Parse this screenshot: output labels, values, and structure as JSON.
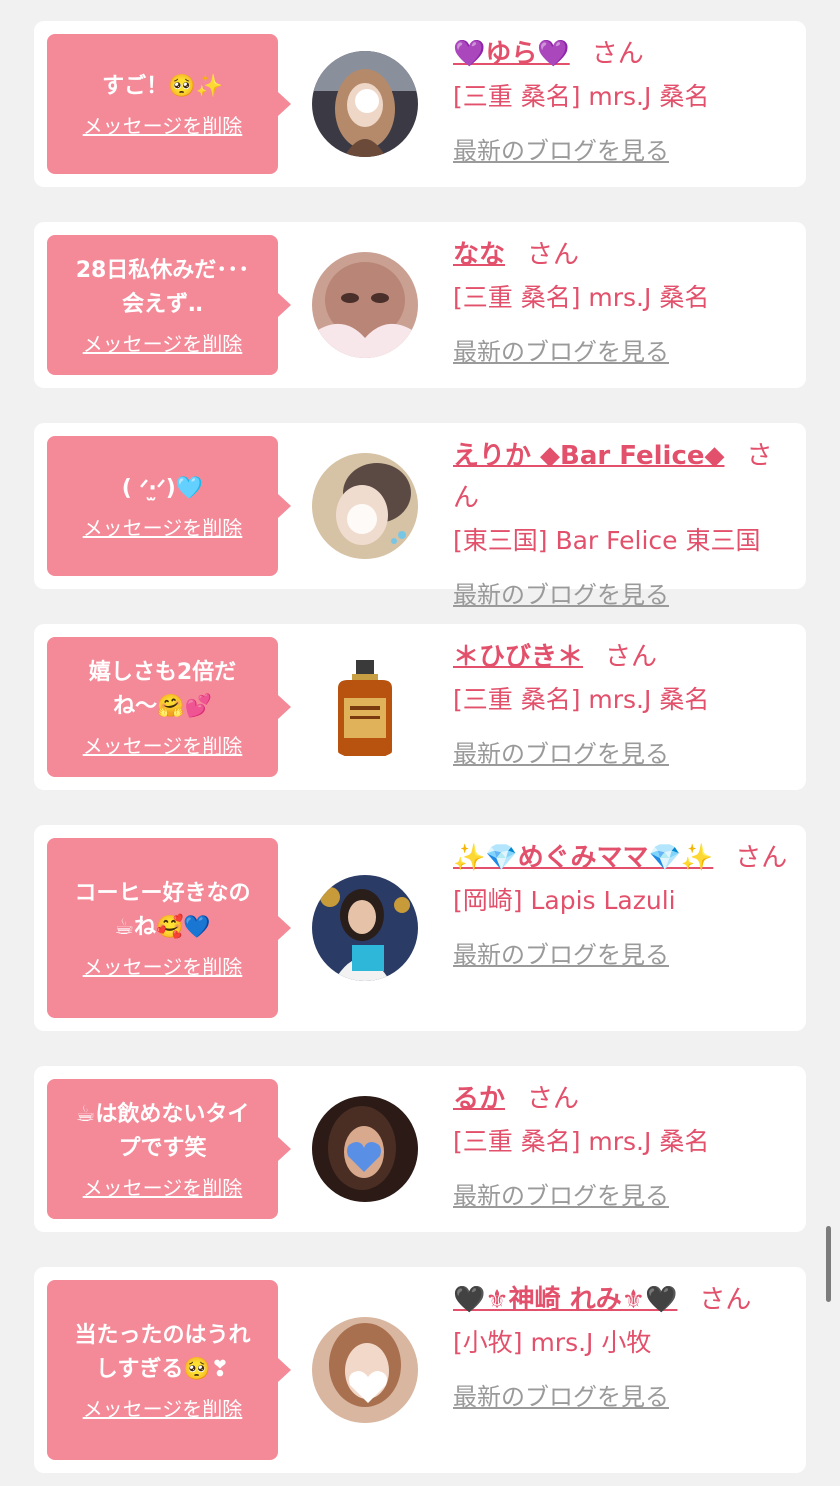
{
  "common": {
    "delete_label": "メッセージを削除",
    "san_label": "さん",
    "blog_label": "最新のブログを見る"
  },
  "colors": {
    "bubble": "#f48a98",
    "name": "#e2506b",
    "blog_link": "#9a9a9a",
    "background": "#f1f1f1"
  },
  "items": [
    {
      "message": "すご！🥺✨",
      "name": "💜ゆら💜",
      "shop": "[三重 桑名] mrs.J 桑名",
      "avatar_icon": "avatar-woman-long-hair-icon"
    },
    {
      "message": "28日私休みだ･･･\n会えず‥",
      "name": "なな",
      "shop": "[三重 桑名] mrs.J 桑名",
      "avatar_icon": "avatar-woman-closeup-icon"
    },
    {
      "message": "( ᐟ‧̫ᐟ)🩵",
      "name": "えりか ◆Bar Felice◆",
      "shop": "[東三国] Bar Felice 東三国",
      "avatar_icon": "avatar-woman-blurred-icon"
    },
    {
      "message": "嬉しさも2倍だ\nね〜🤗💕",
      "name": "＊ひびき＊",
      "shop": "[三重 桑名] mrs.J 桑名",
      "avatar_icon": "whisky-bottle-icon"
    },
    {
      "message": "コーヒー好きなの\n☕ね🥰💙",
      "name": "✨💎めぐみママ💎✨",
      "shop": "[岡崎] Lapis Lazuli",
      "avatar_icon": "avatar-woman-gift-icon"
    },
    {
      "message": "☕は飲めないタイ\nプです笑",
      "name": "るか",
      "shop": "[三重 桑名] mrs.J 桑名",
      "avatar_icon": "avatar-woman-heart-icon"
    },
    {
      "message": "当たったのはうれ\nしすぎる🥺❣",
      "name": "🖤⚜神崎 れみ⚜🖤",
      "shop": "[小牧] mrs.J 小牧",
      "avatar_icon": "avatar-woman-white-heart-icon"
    }
  ]
}
